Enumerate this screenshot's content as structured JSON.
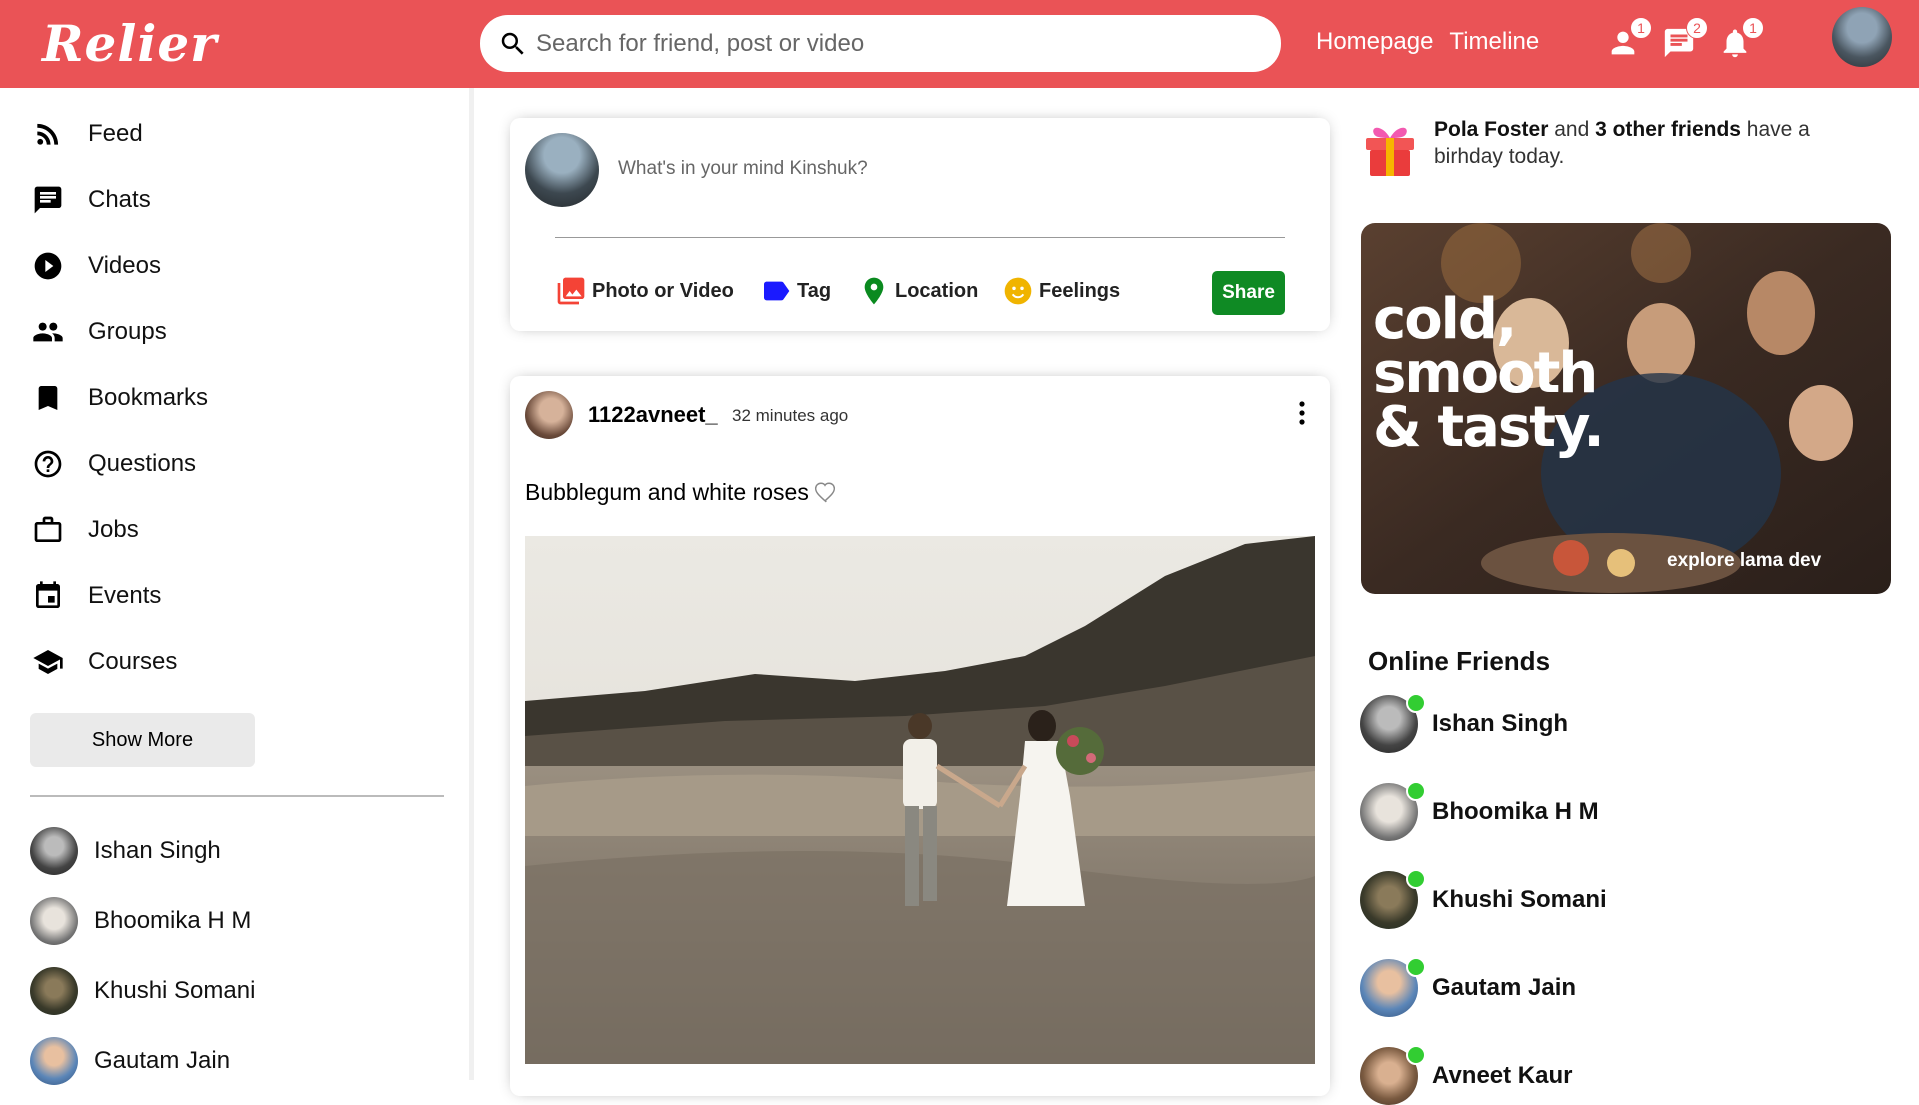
{
  "topbar": {
    "logo": "Relier",
    "search_placeholder": "Search for friend, post or video",
    "links": [
      "Homepage",
      "Timeline"
    ],
    "badges": {
      "friends": "1",
      "messages": "2",
      "notifications": "1"
    },
    "accent_color": "#ea5356"
  },
  "sidebar": {
    "items": [
      {
        "label": "Feed",
        "icon": "rss-feed-icon"
      },
      {
        "label": "Chats",
        "icon": "chat-icon"
      },
      {
        "label": "Videos",
        "icon": "play-circle-icon"
      },
      {
        "label": "Groups",
        "icon": "group-icon"
      },
      {
        "label": "Bookmarks",
        "icon": "bookmark-icon"
      },
      {
        "label": "Questions",
        "icon": "help-circle-icon"
      },
      {
        "label": "Jobs",
        "icon": "briefcase-icon"
      },
      {
        "label": "Events",
        "icon": "calendar-icon"
      },
      {
        "label": "Courses",
        "icon": "school-icon"
      }
    ],
    "show_more": "Show More",
    "friends": [
      "Ishan Singh",
      "Bhoomika H M",
      "Khushi Somani",
      "Gautam Jain"
    ]
  },
  "share": {
    "placeholder": "What's in your mind Kinshuk?",
    "options": [
      "Photo or Video",
      "Tag",
      "Location",
      "Feelings"
    ],
    "button": "Share",
    "button_color": "#0f8a24"
  },
  "post": {
    "username": "1122avneet_",
    "time": "32 minutes ago",
    "text": "Bubblegum and white roses"
  },
  "rightbar": {
    "birthday": {
      "name": "Pola Foster",
      "mid": " and ",
      "others": "3 other friends",
      "tail": " have a birhday today."
    },
    "ad": {
      "line1": "cold,",
      "line2": "smooth",
      "line3": "& tasty.",
      "footer": "explore lama dev"
    },
    "online_title": "Online Friends",
    "online_friends": [
      "Ishan Singh",
      "Bhoomika H M",
      "Khushi Somani",
      "Gautam Jain",
      "Avneet Kaur"
    ],
    "online_color": "#32cd32"
  }
}
